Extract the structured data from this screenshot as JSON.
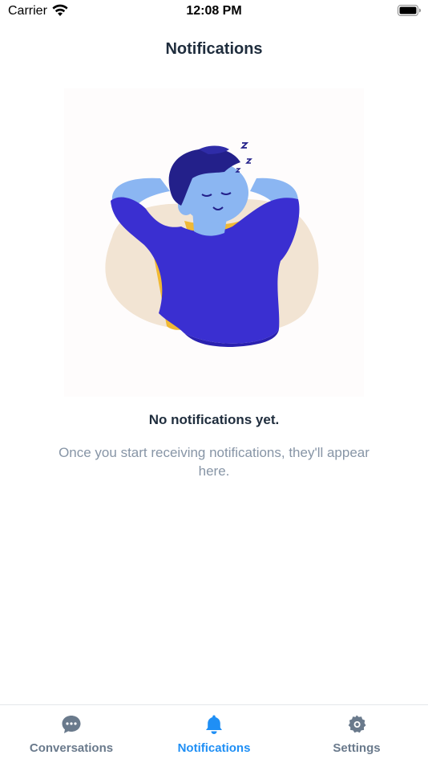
{
  "status_bar": {
    "carrier": "Carrier",
    "time": "12:08 PM"
  },
  "header": {
    "title": "Notifications"
  },
  "empty_state": {
    "title": "No notifications yet.",
    "description": "Once you start receiving notifications, they'll appear here.",
    "illustration": "sleeping-person-illustration"
  },
  "tab_bar": {
    "tabs": [
      {
        "label": "Conversations",
        "icon": "chat-bubble-icon",
        "active": false
      },
      {
        "label": "Notifications",
        "icon": "bell-icon",
        "active": true
      },
      {
        "label": "Settings",
        "icon": "gear-icon",
        "active": false
      }
    ]
  },
  "colors": {
    "accent": "#1f8ff5",
    "inactive_tab": "#6a7a8c",
    "title_text": "#1f2d3d",
    "muted_text": "#8795a6"
  }
}
